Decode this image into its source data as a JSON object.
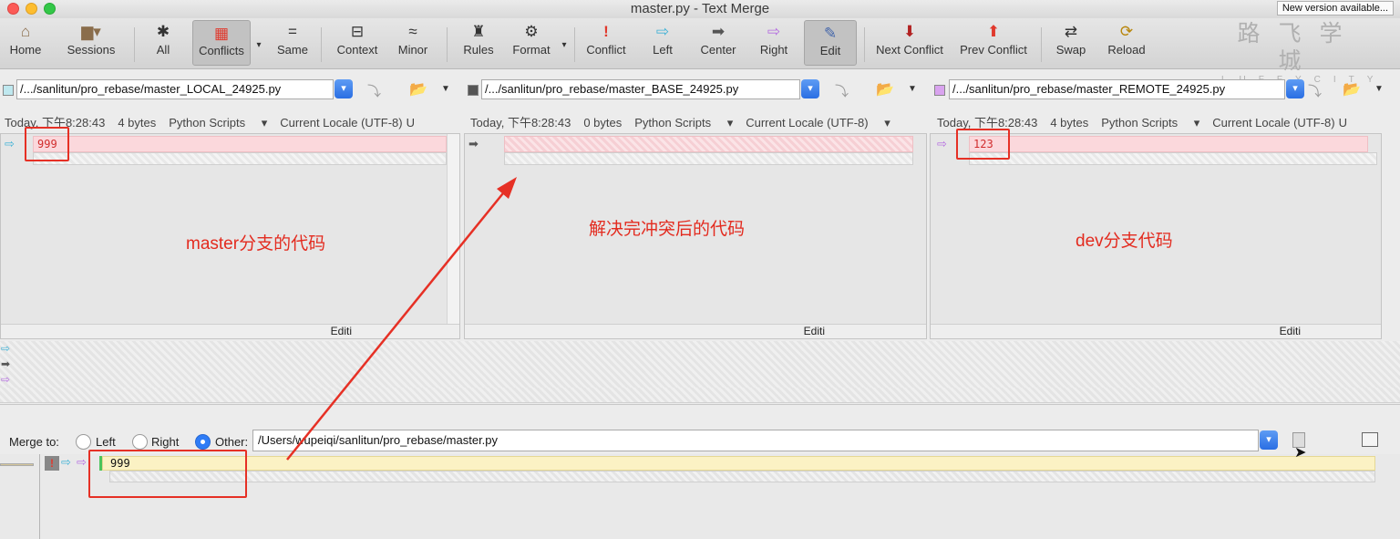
{
  "window": {
    "title": "master.py - Text Merge",
    "new_version": "New version available..."
  },
  "toolbar": {
    "buttons": [
      {
        "label": "Home",
        "icon": "home-icon",
        "glyph": "⌂"
      },
      {
        "label": "Sessions",
        "icon": "briefcase-icon",
        "glyph": "▆▾"
      },
      {
        "label": "All",
        "icon": "asterisk-icon",
        "glyph": "✱"
      },
      {
        "label": "Conflicts",
        "icon": "conflicts-grid-icon",
        "glyph": "▦"
      },
      {
        "label": "Same",
        "icon": "equals-icon",
        "glyph": "="
      },
      {
        "label": "Context",
        "icon": "context-icon",
        "glyph": "⊟"
      },
      {
        "label": "Minor",
        "icon": "approx-icon",
        "glyph": "≈"
      },
      {
        "label": "Rules",
        "icon": "referee-icon",
        "glyph": "♜"
      },
      {
        "label": "Format",
        "icon": "format-gear-icon",
        "glyph": "⚙"
      },
      {
        "label": "Conflict",
        "icon": "exclamation-icon",
        "glyph": "!"
      },
      {
        "label": "Left",
        "icon": "arrow-left-icon",
        "glyph": "⇨"
      },
      {
        "label": "Center",
        "icon": "arrow-center-icon",
        "glyph": "➡"
      },
      {
        "label": "Right",
        "icon": "arrow-right-icon",
        "glyph": "⇨"
      },
      {
        "label": "Edit",
        "icon": "edit-icon",
        "glyph": "✎"
      },
      {
        "label": "Next Conflict",
        "icon": "down-arrow-icon",
        "glyph": "⬇"
      },
      {
        "label": "Prev Conflict",
        "icon": "up-arrow-icon",
        "glyph": "⬆"
      },
      {
        "label": "Swap",
        "icon": "swap-icon",
        "glyph": "⇄"
      },
      {
        "label": "Reload",
        "icon": "reload-icon",
        "glyph": "⟳"
      }
    ]
  },
  "logo": {
    "text": "路飞学城",
    "sub": "LUFFYCITY"
  },
  "files": {
    "local": {
      "path": "/.../sanlitun/pro_rebase/master_LOCAL_24925.py",
      "date": "Today, 下午8:28:43",
      "size": "4 bytes",
      "type": "Python Scripts",
      "encoding": "Current Locale (UTF-8)",
      "trailing": "U",
      "line1": "999",
      "editi": "Editi",
      "color": "#bfe8ef"
    },
    "base": {
      "path": "/.../sanlitun/pro_rebase/master_BASE_24925.py",
      "date": "Today, 下午8:28:43",
      "size": "0 bytes",
      "type": "Python Scripts",
      "encoding": "Current Locale (UTF-8)",
      "line1": "",
      "editi": "Editi",
      "color": "#555555"
    },
    "remote": {
      "path": "/.../sanlitun/pro_rebase/master_REMOTE_24925.py",
      "date": "Today, 下午8:28:43",
      "size": "4 bytes",
      "type": "Python Scripts",
      "encoding": "Current Locale (UTF-8)",
      "trailing": "U",
      "line1": "123",
      "editi": "Editi",
      "color": "#d9a3ef"
    }
  },
  "annotations": {
    "left": "master分支的代码",
    "center": "解决完冲突后的代码",
    "right": "dev分支代码"
  },
  "merge": {
    "label": "Merge to:",
    "left": "Left",
    "right": "Right",
    "other": "Other:",
    "path": "/Users/wupeiqi/sanlitun/pro_rebase/master.py",
    "selected": "Other"
  },
  "output": {
    "line1": "999"
  }
}
